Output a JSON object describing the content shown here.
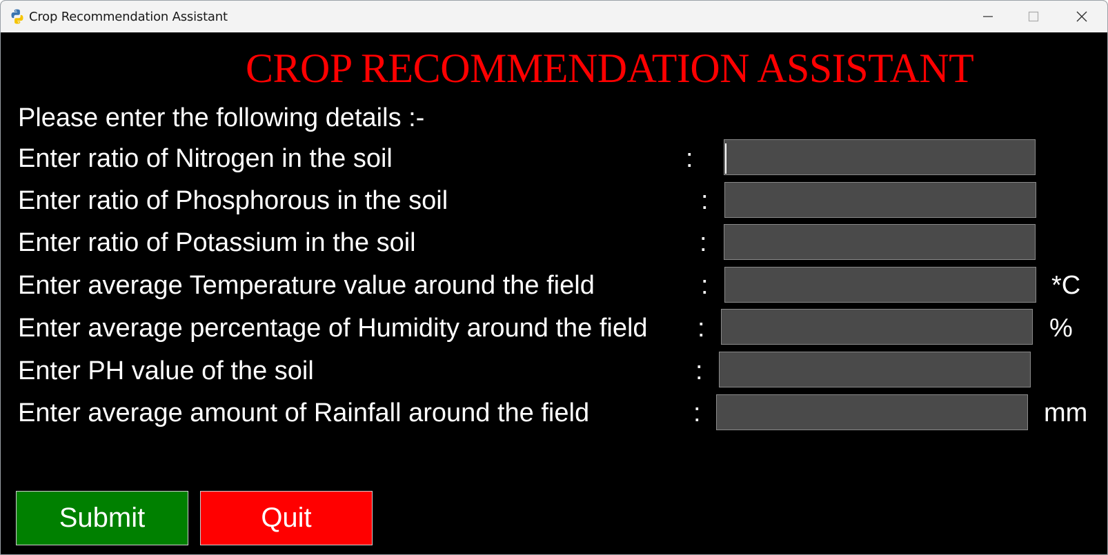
{
  "window": {
    "title": "Crop Recommendation Assistant",
    "app_icon": "python-icon"
  },
  "heading": "CROP RECOMMENDATION ASSISTANT",
  "intro": "Please enter the following details :-",
  "colon": ":",
  "fields": [
    {
      "label": "Enter ratio of Nitrogen in the soil",
      "value": "",
      "unit": ""
    },
    {
      "label": "Enter ratio of Phosphorous in the soil",
      "value": "",
      "unit": ""
    },
    {
      "label": "Enter ratio of Potassium in the soil",
      "value": "",
      "unit": ""
    },
    {
      "label": "Enter average Temperature value around the field",
      "value": "",
      "unit": "*C"
    },
    {
      "label": "Enter average percentage of Humidity around the field",
      "value": "",
      "unit": "%"
    },
    {
      "label": "Enter PH value of the soil",
      "value": "",
      "unit": ""
    },
    {
      "label": "Enter average amount of Rainfall around the field",
      "value": "",
      "unit": "mm"
    }
  ],
  "buttons": {
    "submit": "Submit",
    "quit": "Quit"
  },
  "colors": {
    "heading": "#ff0000",
    "background": "#000000",
    "field_bg": "#4a4a4a",
    "submit_bg": "#008000",
    "quit_bg": "#ff0000"
  }
}
